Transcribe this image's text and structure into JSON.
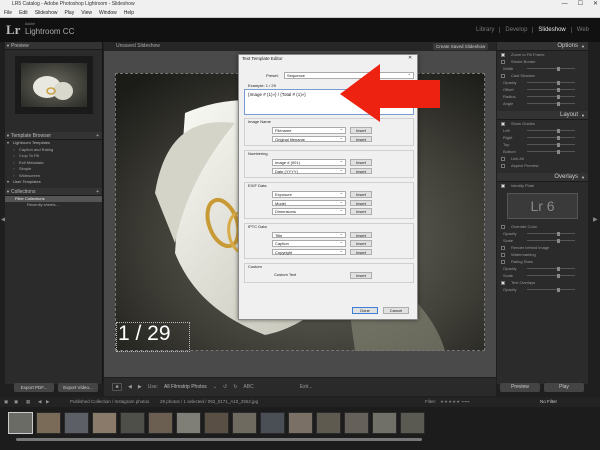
{
  "window": {
    "title": "LR5 Catalog - Adobe Photoshop Lightroom - Slideshow",
    "controls": [
      "—",
      "☐",
      "✕"
    ]
  },
  "menu": [
    "File",
    "Edit",
    "Slideshow",
    "Play",
    "View",
    "Window",
    "Help"
  ],
  "identity": {
    "logo": "Lr",
    "adobe": "Adobe",
    "product": "Lightroom CC"
  },
  "modules": [
    "Library",
    "Develop",
    "Slideshow",
    "Web"
  ],
  "left_panel": {
    "preview_label": "Preview",
    "template_browser_label": "Template Browser",
    "template_items": [
      {
        "label": "Lightroom Templates",
        "folder": true
      },
      {
        "label": "Caption and Rating",
        "folder": false
      },
      {
        "label": "Crop To Fill",
        "folder": false
      },
      {
        "label": "Exif Metadata",
        "folder": false
      },
      {
        "label": "Simple",
        "folder": false
      },
      {
        "label": "Widescreen",
        "folder": false
      },
      {
        "label": "User Templates",
        "folder": true
      }
    ],
    "collections_label": "Collections",
    "collection_items": [
      {
        "label": "Filter Collections",
        "selected": true
      },
      {
        "label": "Recently sheets...",
        "selected": false
      }
    ],
    "export_pdf": "Export PDF...",
    "export_video": "Export Video..."
  },
  "main": {
    "unsaved_label": "Unsaved Slideshow",
    "create_saved": "Create Saved Slideshow",
    "slide_counter": "1 / 29",
    "toolbar": {
      "content_label": "Use:",
      "content_value": "All Filmstrip Photos",
      "abc": "ABC",
      "extra": "Extr..."
    }
  },
  "dialog": {
    "title": "Text Template Editor",
    "close": "✕",
    "preset_label": "Preset:",
    "preset_value": "Sequence",
    "example_label": "Example: 1 / 29",
    "token_text": "{Image # (1)»} / {Total # (1)»}",
    "groups": [
      {
        "label": "Image Name",
        "rows": [
          {
            "value": "Filename",
            "button": "Insert"
          },
          {
            "value": "Original filename",
            "button": "Insert"
          }
        ]
      },
      {
        "label": "Numbering",
        "rows": [
          {
            "value": "Image # (001)",
            "button": "Insert"
          },
          {
            "value": "Date (YYYY)",
            "button": "Insert"
          }
        ]
      },
      {
        "label": "EXIF Data",
        "rows": [
          {
            "value": "Exposure",
            "button": "Insert"
          },
          {
            "value": "Model",
            "button": "Insert"
          },
          {
            "value": "Dimensions",
            "button": "Insert"
          }
        ]
      },
      {
        "label": "IPTC Data",
        "rows": [
          {
            "value": "Title",
            "button": "Insert"
          },
          {
            "value": "Caption",
            "button": "Insert"
          },
          {
            "value": "Copyright",
            "button": "Insert"
          }
        ]
      },
      {
        "label": "Custom",
        "rows": [
          {
            "value": "Custom Text",
            "button": "Insert"
          }
        ]
      }
    ],
    "done": "Done",
    "cancel": "Cancel"
  },
  "right_panel": {
    "options_label": "Options",
    "options_rows": [
      {
        "label": "Zoom to Fill Frame",
        "checked": true,
        "slider": false
      },
      {
        "label": "Stroke Border",
        "checked": false,
        "slider": false
      },
      {
        "label": "Width",
        "checked": false,
        "slider": true
      },
      {
        "label": "Cast Shadow",
        "checked": false,
        "slider": false
      },
      {
        "label": "Opacity",
        "checked": false,
        "slider": true
      },
      {
        "label": "Offset",
        "checked": false,
        "slider": true
      },
      {
        "label": "Radius",
        "checked": false,
        "slider": true
      },
      {
        "label": "Angle",
        "checked": false,
        "slider": true
      }
    ],
    "layout_label": "Layout",
    "layout_rows": [
      {
        "label": "Show Guides",
        "checked": true,
        "slider": false
      },
      {
        "label": "Left",
        "checked": false,
        "slider": true
      },
      {
        "label": "Right",
        "checked": false,
        "slider": true
      },
      {
        "label": "Top",
        "checked": false,
        "slider": true
      },
      {
        "label": "Bottom",
        "checked": false,
        "slider": true
      },
      {
        "label": "Link All",
        "checked": false,
        "slider": false
      },
      {
        "label": "Aspect Preview",
        "checked": false,
        "slider": false
      }
    ],
    "overlays_label": "Overlays",
    "overlay_rows": [
      {
        "label": "Identity Plate",
        "checked": true,
        "slider": false
      }
    ],
    "identity_plate_text": "Lr 6",
    "overlay_rows_2": [
      {
        "label": "Override Color",
        "checked": false,
        "slider": false
      },
      {
        "label": "Opacity",
        "checked": false,
        "slider": true
      },
      {
        "label": "Scale",
        "checked": false,
        "slider": true
      },
      {
        "label": "Render behind image",
        "checked": false,
        "slider": false
      },
      {
        "label": "Watermarking",
        "checked": false,
        "slider": false
      },
      {
        "label": "Rating Stars",
        "checked": false,
        "slider": false
      },
      {
        "label": "Opacity",
        "checked": false,
        "slider": true
      },
      {
        "label": "Scale",
        "checked": false,
        "slider": true
      },
      {
        "label": "Text Overlays",
        "checked": true,
        "slider": false
      },
      {
        "label": "Opacity",
        "checked": false,
        "slider": true
      }
    ],
    "preview_btn": "Preview",
    "play_btn": "Play"
  },
  "filmstrip": {
    "collection_path": "Published Collection / Instagram photos",
    "count": "29 photos / 1 selected / 092_0171_A10_2552.jpg",
    "filter_label": "Filter:",
    "no_filter": "No Filter"
  },
  "colors": {
    "arrow": "#ee2211",
    "dialog_bg": "#f0f0f0",
    "panel_bg": "#2b2b2b"
  }
}
